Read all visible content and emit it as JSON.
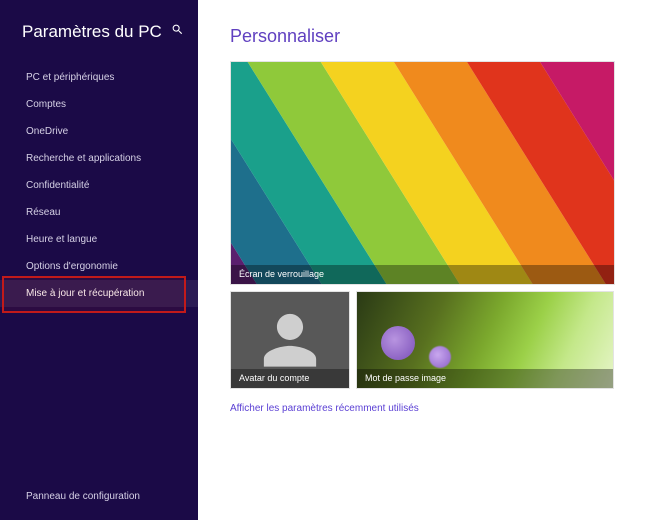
{
  "sidebar": {
    "title": "Paramètres du PC",
    "items": [
      {
        "label": "PC et périphériques"
      },
      {
        "label": "Comptes"
      },
      {
        "label": "OneDrive"
      },
      {
        "label": "Recherche et applications"
      },
      {
        "label": "Confidentialité"
      },
      {
        "label": "Réseau"
      },
      {
        "label": "Heure et langue"
      },
      {
        "label": "Options d'ergonomie"
      },
      {
        "label": "Mise à jour et récupération"
      }
    ],
    "selected_index": 8,
    "highlighted_index": 8,
    "footer": "Panneau de configuration"
  },
  "main": {
    "title": "Personnaliser",
    "tiles": {
      "lock_screen": "Écran de verrouillage",
      "account_picture": "Avatar du compte",
      "picture_password": "Mot de passe image"
    },
    "recent_link": "Afficher les paramètres récemment utilisés"
  },
  "colors": {
    "sidebar_bg": "#1b0a47",
    "accent": "#6040c0",
    "link": "#5a3fd4",
    "highlight_border": "#c21a1a"
  }
}
